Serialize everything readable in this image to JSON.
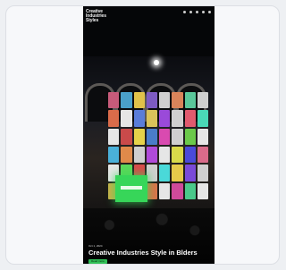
{
  "brand": {
    "lines": [
      "Creative",
      "Industries",
      "Styles"
    ]
  },
  "hero": {
    "date": "Oct 1, 2024",
    "title": "Creative Industries Style in Blders",
    "cta_label": "Read more"
  },
  "colors": {
    "accent_green": "#37d659",
    "background": "#050608",
    "card_bg": "#f7f8fa"
  },
  "icons": [
    "menu-icon",
    "search-icon",
    "share-icon",
    "user-icon",
    "language-icon"
  ]
}
